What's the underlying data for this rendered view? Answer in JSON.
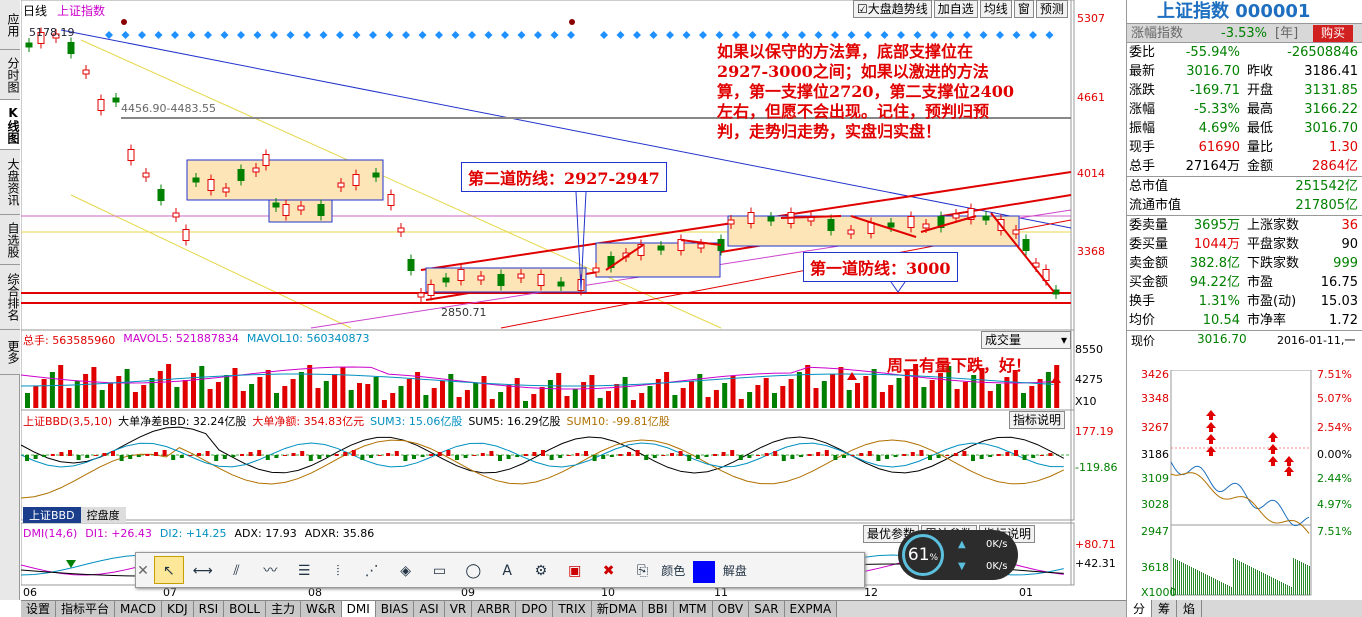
{
  "sidebar": [
    "应用",
    "分时图",
    "K线图",
    "大盘资讯",
    "自选股",
    "综合排名",
    "更多"
  ],
  "chart": {
    "period": "日线",
    "name": "上证指数",
    "buttons": [
      "大盘趋势线",
      "加自选",
      "均线",
      "窗",
      "预测"
    ],
    "price_axis": [
      "5307",
      "4661",
      "4014",
      "3368"
    ],
    "high_label": "5178.19",
    "ma_label": "4456.90-4483.55",
    "low_label": "2850.71",
    "annotation_main": "如果以保守的方法算，底部支撑位在2927-3000之间；如果以激进的方法算，第一支撑位2720，第二支撑位2400左右，但愿不会出现。记住，预判归预判，走势归走势，实盘归实盘！",
    "annotation_line2": "第二道防线：2927-2947",
    "annotation_line1": "第一道防线：3000",
    "annotation_vol": "周二有量下跌，好！"
  },
  "volume": {
    "header": [
      {
        "text": "总手: 563585960",
        "color": "#e00000"
      },
      {
        "text": "MAVOL5: 521887834",
        "color": "#cc00cc"
      },
      {
        "text": "MAVOL10: 560340873",
        "color": "#0090c0"
      }
    ],
    "dropdown": "成交量",
    "axis": [
      "8550",
      "4275",
      "X10"
    ]
  },
  "bbd": {
    "header": [
      {
        "text": "上证BBD(3,5,10)",
        "color": "#e00000"
      },
      {
        "text": "大单净差BBD: 32.24亿股",
        "color": "#000000"
      },
      {
        "text": "大单净额: 354.83亿元",
        "color": "#e00000"
      },
      {
        "text": "SUM3: 15.06亿股",
        "color": "#0090c0"
      },
      {
        "text": "SUM5: 16.29亿股",
        "color": "#000000"
      },
      {
        "text": "SUM10: -99.81亿股",
        "color": "#b07000"
      }
    ],
    "button": "指标说明",
    "axis": [
      "177.19",
      "-119.86"
    ],
    "tabs": [
      "上证BBD",
      "控盘度"
    ]
  },
  "dmi": {
    "header": [
      {
        "text": "DMI(14,6)",
        "color": "#cc00cc"
      },
      {
        "text": "DI1: +26.43",
        "color": "#cc00cc"
      },
      {
        "text": "DI2: +14.25",
        "color": "#0090c0"
      },
      {
        "text": "ADX: 17.93",
        "color": "#000000"
      },
      {
        "text": "ADXR: 35.86",
        "color": "#000000"
      }
    ],
    "buttons": [
      "最优参数",
      "累计参数",
      "指标说明"
    ],
    "axis": [
      "+80.71",
      "+42.31"
    ]
  },
  "time_axis": [
    "06",
    "07",
    "08",
    "09",
    "10",
    "11",
    "12",
    "01"
  ],
  "toolbar": {
    "color_label": "颜色",
    "unlock_label": "解盘"
  },
  "speed": {
    "percent": "61",
    "unit": "%",
    "up": "0K/s",
    "down": "0K/s"
  },
  "bottom_tabs": [
    "设置",
    "指标平台",
    "MACD",
    "KDJ",
    "RSI",
    "BOLL",
    "主力",
    "W&R",
    "DMI",
    "BIAS",
    "ASI",
    "VR",
    "ARBR",
    "DPO",
    "TRIX",
    "新DMA",
    "BBI",
    "MTM",
    "OBV",
    "SAR",
    "EXPMA"
  ],
  "active_tab": "DMI",
  "quote": {
    "title": "上证指数 000001",
    "strip": {
      "label": "涨幅指数",
      "value": "-3.53%",
      "tag": "[年]",
      "buy": "购买"
    },
    "rows": [
      {
        "l1": "委比",
        "v1": "-55.94%",
        "c1": "green",
        "l2": "",
        "v2": "-26508846",
        "c2": "green"
      },
      {
        "l1": "最新",
        "v1": "3016.70",
        "c1": "green",
        "l2": "昨收",
        "v2": "3186.41",
        "c2": "black"
      },
      {
        "l1": "涨跌",
        "v1": "-169.71",
        "c1": "green",
        "l2": "开盘",
        "v2": "3131.85",
        "c2": "green"
      },
      {
        "l1": "涨幅",
        "v1": "-5.33%",
        "c1": "green",
        "l2": "最高",
        "v2": "3166.22",
        "c2": "green"
      },
      {
        "l1": "振幅",
        "v1": "4.69%",
        "c1": "green",
        "l2": "最低",
        "v2": "3016.70",
        "c2": "green"
      },
      {
        "l1": "现手",
        "v1": "61690",
        "c1": "red",
        "l2": "量比",
        "v2": "1.30",
        "c2": "red"
      },
      {
        "l1": "总手",
        "v1": "27164万",
        "c1": "black",
        "l2": "金额",
        "v2": "2864亿",
        "c2": "red"
      }
    ],
    "rows2": [
      {
        "l1": "总市值",
        "v1": "251542亿"
      },
      {
        "l1": "流通市值",
        "v1": "217805亿"
      }
    ],
    "rows3": [
      {
        "l1": "委卖量",
        "v1": "3695万",
        "c1": "green",
        "l2": "上涨家数",
        "v2": "36",
        "c2": "red"
      },
      {
        "l1": "委买量",
        "v1": "1044万",
        "c1": "red",
        "l2": "平盘家数",
        "v2": "90",
        "c2": "black"
      },
      {
        "l1": "卖金额",
        "v1": "382.8亿",
        "c1": "green",
        "l2": "下跌家数",
        "v2": "999",
        "c2": "green"
      },
      {
        "l1": "买金额",
        "v1": "94.22亿",
        "c1": "green",
        "l2": "市盈",
        "v2": "16.75",
        "c2": "black"
      },
      {
        "l1": "换手",
        "v1": "1.31%",
        "c1": "green",
        "l2": "市盈(动)",
        "v2": "15.03",
        "c2": "black"
      },
      {
        "l1": "均价",
        "v1": "10.54",
        "c1": "green",
        "l2": "市净率",
        "v2": "1.72",
        "c2": "black"
      }
    ],
    "mini": {
      "label": "现价",
      "price": "3016.70",
      "date": "2016-01-11,一",
      "left_axis": [
        "3426",
        "3348",
        "3267",
        "3186",
        "3109",
        "3028",
        "2947",
        "3618",
        "X1000"
      ],
      "right_axis": [
        "7.51%",
        "5.07%",
        "2.54%",
        "0.00%",
        "2.44%",
        "4.97%",
        "7.51%"
      ]
    },
    "bottom_tabs": [
      "分",
      "筹",
      "焰"
    ]
  }
}
